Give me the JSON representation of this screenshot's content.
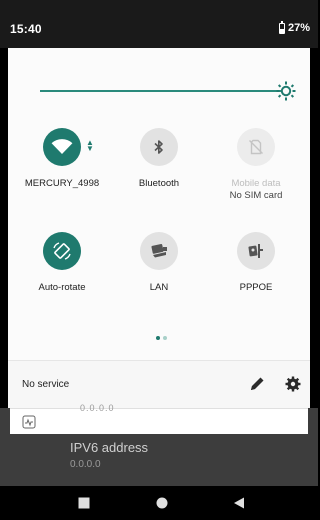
{
  "status_bar": {
    "time": "15:40",
    "battery_icon": "battery-icon",
    "battery": "27%"
  },
  "quick_settings": {
    "brightness": {
      "level": 1.0,
      "icon": "brightness-icon",
      "accent_color": "#1f7a6e"
    },
    "tiles": [
      {
        "label": "MERCURY_4998",
        "icon": "wifi-icon",
        "state": "on",
        "activity_indicator": "up-down-arrows"
      },
      {
        "label": "Bluetooth",
        "icon": "bluetooth-icon",
        "state": "off"
      },
      {
        "label": "Mobile data",
        "sublabel": "No SIM card",
        "icon": "no-sim-icon",
        "state": "disabled"
      },
      {
        "label": "Auto-rotate",
        "icon": "auto-rotate-icon",
        "state": "on"
      },
      {
        "label": "LAN",
        "icon": "lan-icon",
        "state": "off"
      },
      {
        "label": "PPPOE",
        "icon": "pppoe-icon",
        "state": "off"
      }
    ],
    "pages": {
      "count": 2,
      "current": 1
    },
    "footer": {
      "carrier_text": "No service",
      "edit_icon": "pencil-icon",
      "settings_icon": "gear-icon"
    }
  },
  "background_app": {
    "ghost_value": "0.0.0.0",
    "ipv6_label": "IPV6 address",
    "ipv6_value": "0.0.0.0",
    "card_icon": "activity-icon"
  },
  "navigation_bar": {
    "recents_icon": "square-icon",
    "home_icon": "circle-icon",
    "back_icon": "triangle-back-icon"
  }
}
